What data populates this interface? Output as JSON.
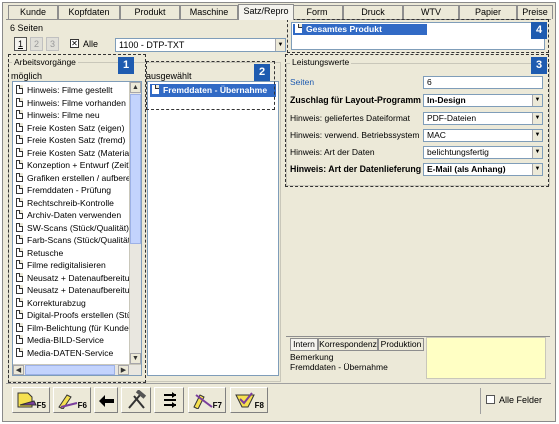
{
  "tabs": [
    {
      "label": "Kunde",
      "active": false
    },
    {
      "label": "Kopfdaten",
      "active": false
    },
    {
      "label": "Produkt",
      "active": false
    },
    {
      "label": "Maschine",
      "active": false
    },
    {
      "label": "Satz/Repro",
      "active": true
    },
    {
      "label": "Form",
      "active": false
    },
    {
      "label": "Druck",
      "active": false
    },
    {
      "label": "WTV",
      "active": false
    },
    {
      "label": "Papier",
      "active": false
    },
    {
      "label": "Preise",
      "active": false
    }
  ],
  "pages_label": "6 Seiten",
  "page_buttons": [
    "1",
    "2",
    "3"
  ],
  "alle_checkbox": {
    "label": "Alle",
    "checked": true
  },
  "combo_value": "1100 - DTP-TXT",
  "product_item": "Gesamtes Produkt",
  "badges": [
    "1",
    "2",
    "3",
    "4"
  ],
  "arbeitsvorgaenge": {
    "title": "Arbeitsvorgänge",
    "possible_label": "möglich",
    "items": [
      "Hinweis: Filme gestellt",
      "Hinweis: Filme vorhanden",
      "Hinweis: Filme neu",
      "Freie Kosten Satz (eigen)",
      "Freie Kosten Satz (fremd)",
      "Freie Kosten Satz (Material)",
      "Konzeption + Entwurf (Zeit)",
      "Grafiken erstellen / aufbereit",
      "Fremddaten - Prüfung",
      "Rechtschreib-Kontrolle",
      "Archiv-Daten verwenden",
      "SW-Scans (Stück/Qualität)",
      "Farb-Scans (Stück/Qualität)",
      "Retusche",
      "Filme redigitalisieren",
      "Neusatz + Datenaufbereitun",
      "Neusatz + Datenaufbereitun",
      "Korrekturabzug",
      "Digital-Proofs erstellen (Stück",
      "Film-Belichtung (für Kunde)",
      "Media-BILD-Service",
      "Media-DATEN-Service"
    ],
    "selected_label": "ausgewählt",
    "selected_items": [
      "Fremddaten - Übernahme"
    ]
  },
  "leistungswerte": {
    "title": "Leistungswerte",
    "rows": [
      {
        "label": "Seiten",
        "value": "6",
        "bold": false,
        "blue": true,
        "dropdown": false
      },
      {
        "label": "Zuschlag für Layout-Programm",
        "value": "In-Design",
        "bold": true,
        "blue": false,
        "dropdown": true
      },
      {
        "label": "Hinweis: geliefertes Dateiformat",
        "value": "PDF-Dateien",
        "bold": false,
        "blue": false,
        "dropdown": true
      },
      {
        "label": "Hinweis: verwend. Betriebssystem",
        "value": "MAC",
        "bold": false,
        "blue": false,
        "dropdown": true
      },
      {
        "label": "Hinweis: Art der Daten",
        "value": "belichtungsfertig",
        "bold": false,
        "blue": false,
        "dropdown": true
      },
      {
        "label": "Hinweis: Art der Datenlieferung",
        "value": "E-Mail (als Anhang)",
        "bold": true,
        "blue": false,
        "dropdown": true
      }
    ]
  },
  "bottom_tabs": [
    "Intern",
    "Korrespondenz",
    "Produktion"
  ],
  "bemerkung": {
    "label": "Bemerkung",
    "text": "Fremddaten - Übernahme"
  },
  "toolbar": {
    "f5": "F5",
    "f6": "F6",
    "f7": "F7",
    "f8": "F8"
  },
  "alle_felder": {
    "label": "Alle Felder",
    "checked": false
  },
  "colors": {
    "accent": "#1e5bb0",
    "selection": "#316ac5",
    "note_bg": "#ffffc4"
  }
}
